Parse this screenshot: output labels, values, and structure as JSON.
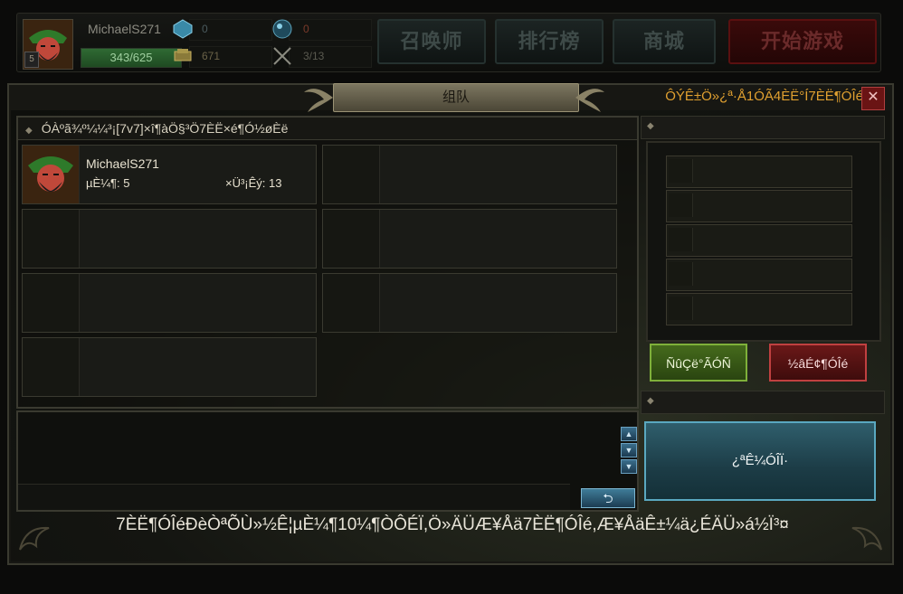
{
  "player": {
    "name": "MichaelS271",
    "level": "5",
    "xp": "343/625",
    "stat_gem": "0",
    "stat_gold": "671",
    "stat_orb": "0",
    "stat_battle": "3/13"
  },
  "top_buttons": {
    "summoner": "召唤师",
    "ranking": "排行榜",
    "shop": "商城",
    "start_game": "开始游戏"
  },
  "window": {
    "title": "组队",
    "header_right": "ÔÝÊ±Ö»¿ª·Å1ÓÃ4ÈË°Í7ÈË¶ÓÎé",
    "close": "✕"
  },
  "team": {
    "header": "ÓÀºã¾º¼¼³¡[7v7]×î¶àÖ§³Ö7ÈË×é¶Ó½øÈë",
    "member": {
      "name": "MichaelS271",
      "line1": "µÈ¼¶: 5",
      "line2": "×Ü³¡Êý: 13"
    }
  },
  "right_panel": {
    "invite_btn": "ÑûÇë°ÃÓÑ",
    "disband_btn": "½âÉ¢¶ÓÎé"
  },
  "chat": {
    "send": "⮌"
  },
  "start_match": "¿ªÊ¼ÓÎÏ·",
  "bottom_info": "7ÈË¶ÓÎéÐèÒªÕÙ»½Ê¦µÈ¼¶10¼¶ÒÔÉÏ,Ö»ÄÜÆ¥Åä7ÈË¶ÓÎé,Æ¥ÅäÊ±¼ä¿ÉÄÜ»á½Ï³¤",
  "colors": {
    "accent_orange": "#e0a030",
    "green_button": "#7fb03a",
    "red_button": "#c04040",
    "blue_button": "#5aa8c0"
  }
}
